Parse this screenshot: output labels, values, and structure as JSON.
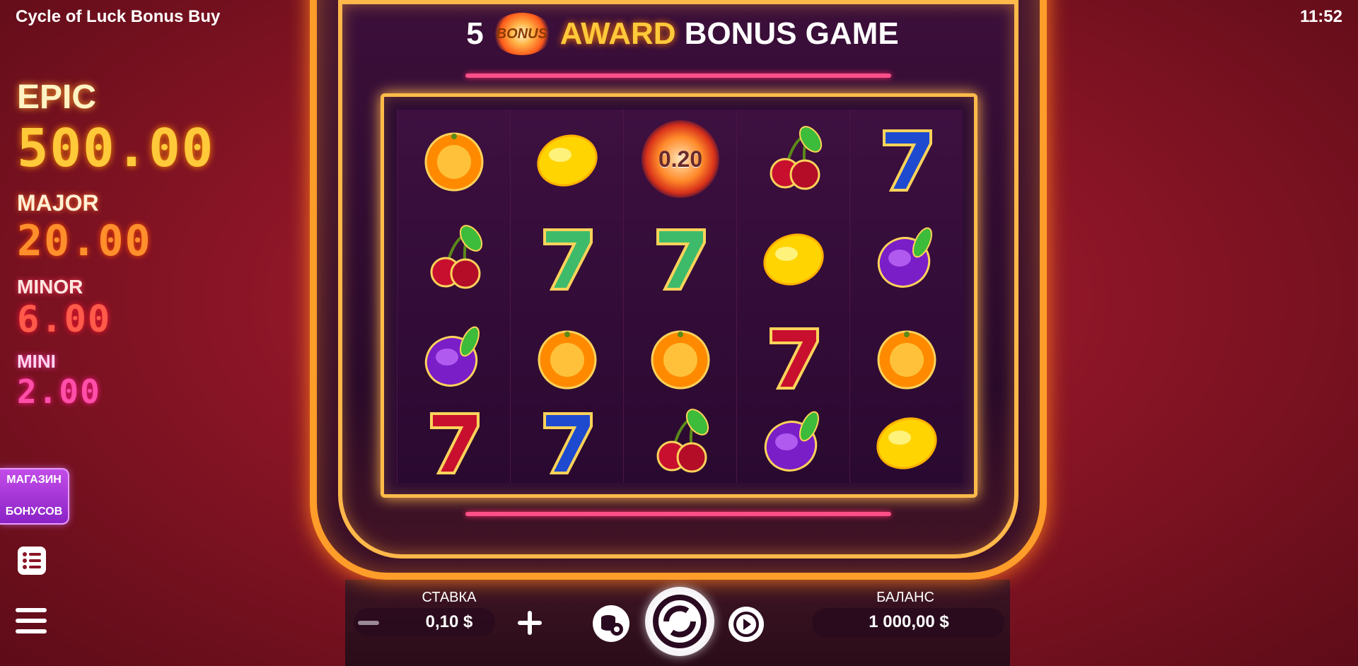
{
  "top_bar": {
    "game_title": "Cycle of Luck Bonus Buy",
    "clock": "11:52"
  },
  "jackpots": [
    {
      "label": "EPIC",
      "value": "500.00",
      "color": "#ffc93a"
    },
    {
      "label": "MAJOR",
      "value": "20.00",
      "color": "#ff8f2c"
    },
    {
      "label": "MINOR",
      "value": "6.00",
      "color": "#ff5a4a"
    },
    {
      "label": "MINI",
      "value": "2.00",
      "color": "#ff4fa8"
    }
  ],
  "left_controls": {
    "shop_label_line1": "МАГАЗИН",
    "shop_label_line2": "БОНУСОВ",
    "list_icon": "paytable-list-icon",
    "menu_icon": "hamburger-menu-icon"
  },
  "banner": {
    "count": "5",
    "badge": "BONUS",
    "award": "AWARD",
    "rest": "BONUS GAME"
  },
  "reels": {
    "columns": [
      [
        "orange",
        "cherry",
        "plum",
        "seven-red"
      ],
      [
        "lemon",
        "seven-green",
        "orange",
        "seven-blue"
      ],
      [
        "bonus-coin",
        "seven-green",
        "orange",
        "cherry"
      ],
      [
        "cherry",
        "lemon",
        "seven-red",
        "plum"
      ],
      [
        "seven-blue",
        "plum",
        "orange",
        "lemon"
      ]
    ],
    "coin_value": "0.20"
  },
  "bottom_bar": {
    "bet_label": "СТАВКА",
    "bet_value": "0,10 $",
    "balance_label": "БАЛАНС",
    "balance_value": "1 000,00 $",
    "buttons": [
      "minus-icon",
      "plus-icon",
      "autoplay-settings-icon",
      "spin-icon",
      "turbo-icon"
    ]
  },
  "colors": {
    "accent_orange": "#ff9d2a",
    "neon_pink": "#ff4f8a",
    "background_red": "#8b1526"
  }
}
